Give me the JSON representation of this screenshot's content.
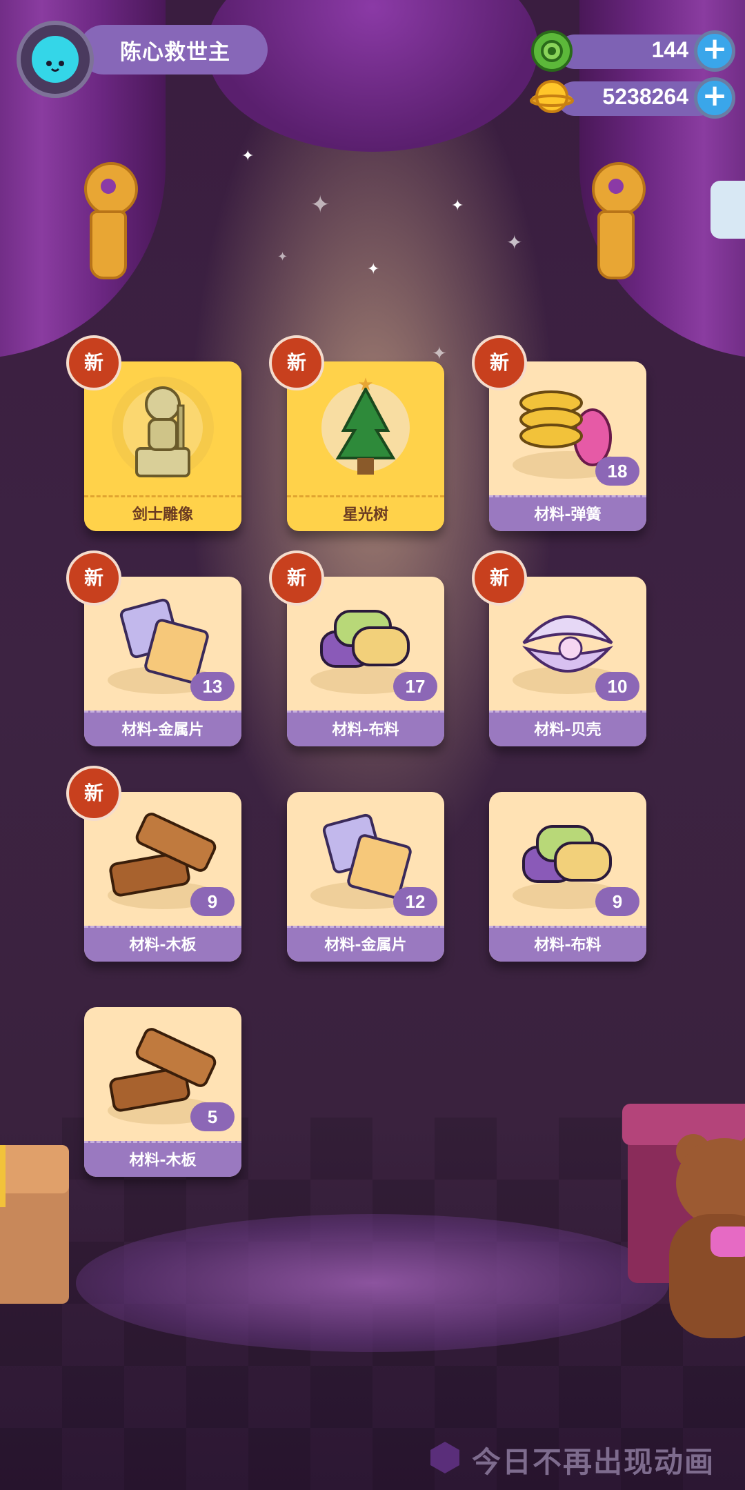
{
  "player": {
    "name": "陈心救世主",
    "avatar_icon": "cat-avatar-icon"
  },
  "currencies": [
    {
      "icon": "green-donut-icon",
      "value": "144"
    },
    {
      "icon": "gold-coin-planet-icon",
      "value": "5238264"
    }
  ],
  "new_badge_text": "新",
  "items": [
    {
      "label": "剑士雕像",
      "icon": "swordsman-statue-icon",
      "is_new": true,
      "count": null,
      "style": "gold"
    },
    {
      "label": "星光树",
      "icon": "starlight-tree-icon",
      "is_new": true,
      "count": null,
      "style": "gold"
    },
    {
      "label": "材料-弹簧",
      "icon": "spring-icon",
      "is_new": true,
      "count": "18",
      "style": "normal"
    },
    {
      "label": "材料-金属片",
      "icon": "metal-sheet-icon",
      "is_new": true,
      "count": "13",
      "style": "normal"
    },
    {
      "label": "材料-布料",
      "icon": "fabric-rolls-icon",
      "is_new": true,
      "count": "17",
      "style": "normal"
    },
    {
      "label": "材料-贝壳",
      "icon": "shell-pearl-icon",
      "is_new": true,
      "count": "10",
      "style": "normal"
    },
    {
      "label": "材料-木板",
      "icon": "wood-plank-icon",
      "is_new": true,
      "count": "9",
      "style": "normal"
    },
    {
      "label": "材料-金属片",
      "icon": "metal-sheet-icon",
      "is_new": false,
      "count": "12",
      "style": "normal"
    },
    {
      "label": "材料-布料",
      "icon": "fabric-rolls-icon",
      "is_new": false,
      "count": "9",
      "style": "normal"
    },
    {
      "label": "材料-木板",
      "icon": "wood-plank-icon",
      "is_new": false,
      "count": "5",
      "style": "normal"
    }
  ],
  "skip_animation_label": "今日不再出现动画",
  "colors": {
    "accent_purple": "#8767b8",
    "badge_red": "#c8401e",
    "card_cream": "#ffe2b4",
    "card_gold": "#ffd24a",
    "plus_blue": "#3aa6ea"
  }
}
